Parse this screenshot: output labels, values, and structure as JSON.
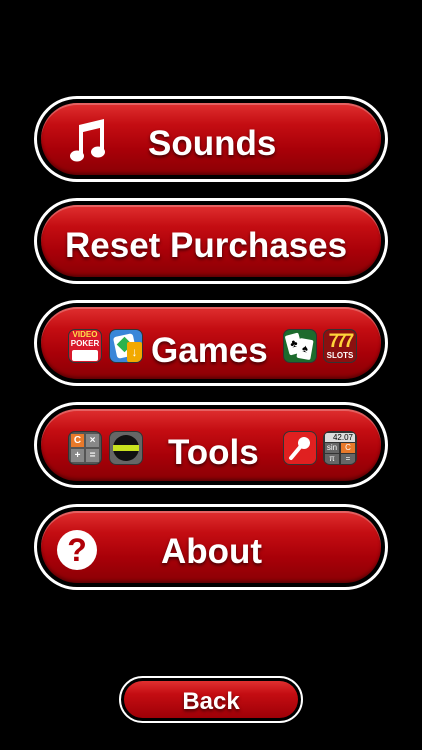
{
  "menu": {
    "sounds": "Sounds",
    "reset": "Reset Purchases",
    "games": "Games",
    "tools": "Tools",
    "about": "About"
  },
  "icons": {
    "video_poker_line1": "VIDEO",
    "video_poker_line2": "POKER",
    "slots_text": "SLOTS",
    "calc_keys": [
      "C",
      "×",
      "+",
      "="
    ],
    "sci_display": "42.07",
    "sci_keys": [
      "sin",
      "C",
      "π",
      "="
    ]
  },
  "back": "Back",
  "colors": {
    "button_red": "#c40d12",
    "border": "#ffffff",
    "background": "#000000"
  }
}
